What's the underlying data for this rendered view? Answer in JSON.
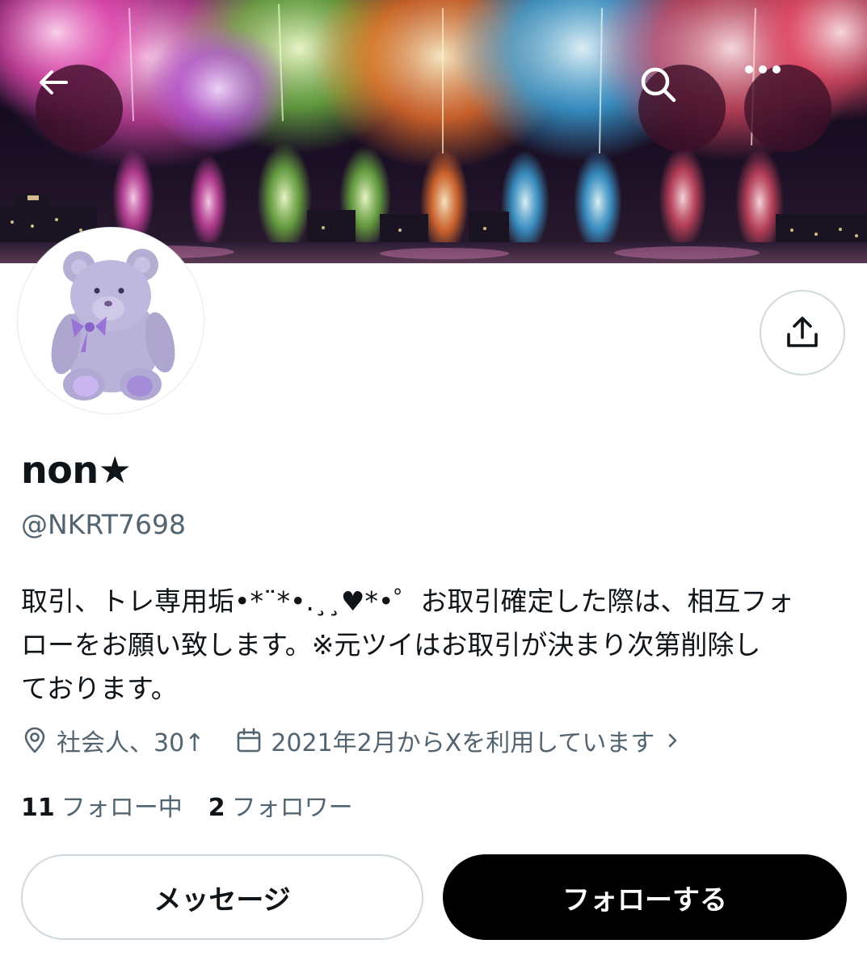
{
  "banner": {
    "description_icon": "fireworks-banner-image"
  },
  "nav": {
    "back_icon": "arrow-left-icon",
    "search_icon": "search-icon",
    "more_icon": "more-horizontal-icon",
    "share_icon": "share-upload-icon"
  },
  "profile": {
    "avatar_icon": "lavender-teddy-bear-avatar",
    "display_name": "non★",
    "handle": "@NKRT7698",
    "bio": "取引、トレ専用垢•*¨*•.¸¸♥*•゜お取引確定した際は、相互フォ\nローをお願い致します。※元ツイはお取引が決まり次第削除し\nております。",
    "location": "社会人、30↑",
    "joined": "2021年2月からXを利用しています"
  },
  "stats": {
    "following_count": "11",
    "following_label": "フォロー中",
    "followers_count": "2",
    "followers_label": "フォロワー"
  },
  "actions": {
    "message_label": "メッセージ",
    "follow_label": "フォローする"
  },
  "colors": {
    "text_primary": "#0f1419",
    "text_secondary": "#536471",
    "border": "#cfd9de",
    "follow_button_bg": "#000000",
    "overlay_button_bg": "#3c1028"
  }
}
